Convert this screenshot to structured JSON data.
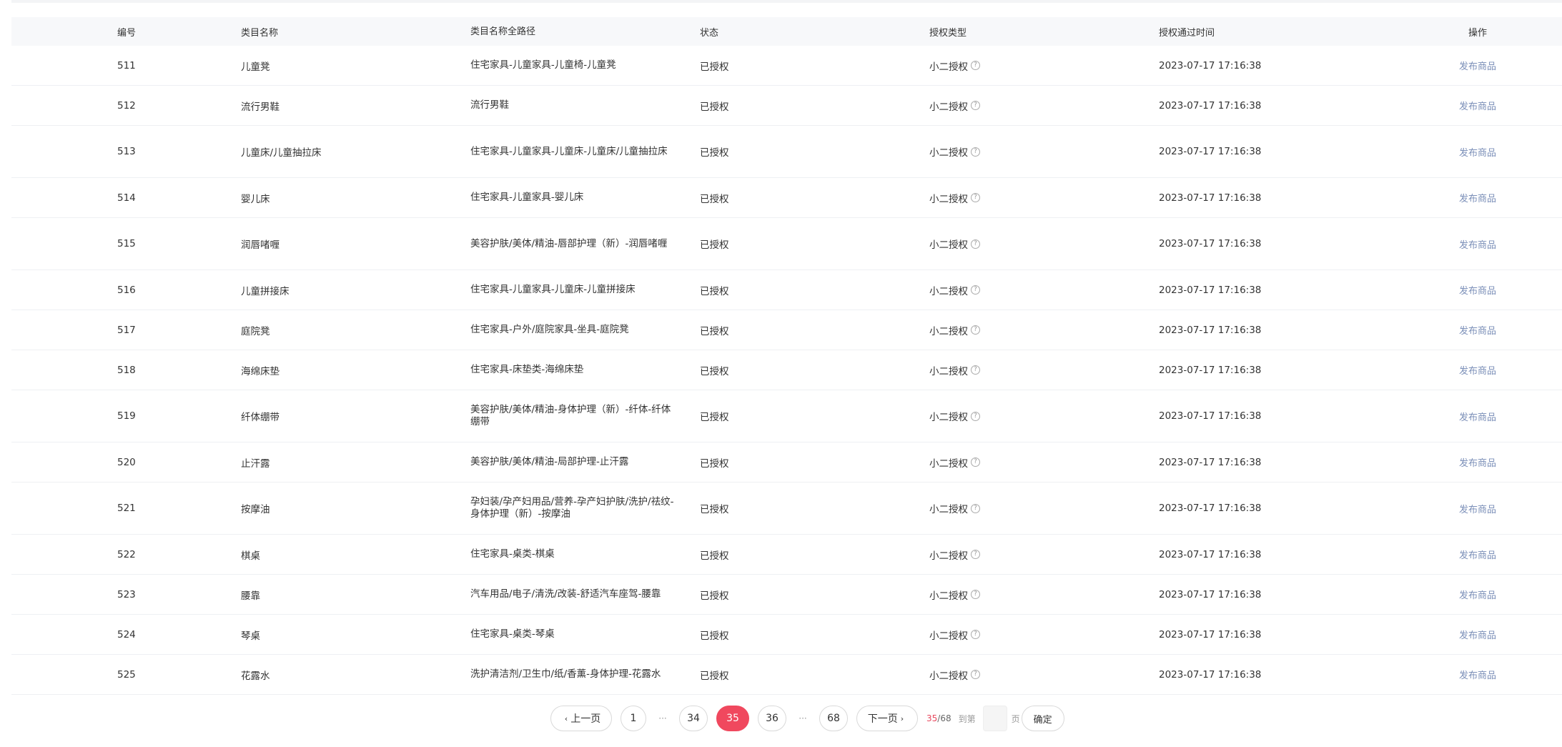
{
  "table": {
    "headers": [
      "编号",
      "类目名称",
      "类目名称全路径",
      "状态",
      "授权类型",
      "授权通过时间",
      "操作"
    ],
    "rows": [
      {
        "id": "511",
        "name": "儿童凳",
        "path": "住宅家具-儿童家具-儿童椅-儿童凳",
        "status": "已授权",
        "auth_type": "小二授权",
        "time": "2023-07-17 17:16:38",
        "action": "发布商品"
      },
      {
        "id": "512",
        "name": "流行男鞋",
        "path": "流行男鞋",
        "status": "已授权",
        "auth_type": "小二授权",
        "time": "2023-07-17 17:16:38",
        "action": "发布商品"
      },
      {
        "id": "513",
        "name": "儿童床/儿童抽拉床",
        "path": "住宅家具-儿童家具-儿童床-儿童床/儿童抽拉床",
        "status": "已授权",
        "auth_type": "小二授权",
        "time": "2023-07-17 17:16:38",
        "action": "发布商品"
      },
      {
        "id": "514",
        "name": "婴儿床",
        "path": "住宅家具-儿童家具-婴儿床",
        "status": "已授权",
        "auth_type": "小二授权",
        "time": "2023-07-17 17:16:38",
        "action": "发布商品"
      },
      {
        "id": "515",
        "name": "润唇啫喱",
        "path": "美容护肤/美体/精油-唇部护理（新）-润唇啫喱",
        "status": "已授权",
        "auth_type": "小二授权",
        "time": "2023-07-17 17:16:38",
        "action": "发布商品"
      },
      {
        "id": "516",
        "name": "儿童拼接床",
        "path": "住宅家具-儿童家具-儿童床-儿童拼接床",
        "status": "已授权",
        "auth_type": "小二授权",
        "time": "2023-07-17 17:16:38",
        "action": "发布商品"
      },
      {
        "id": "517",
        "name": "庭院凳",
        "path": "住宅家具-户外/庭院家具-坐具-庭院凳",
        "status": "已授权",
        "auth_type": "小二授权",
        "time": "2023-07-17 17:16:38",
        "action": "发布商品"
      },
      {
        "id": "518",
        "name": "海绵床垫",
        "path": "住宅家具-床垫类-海绵床垫",
        "status": "已授权",
        "auth_type": "小二授权",
        "time": "2023-07-17 17:16:38",
        "action": "发布商品"
      },
      {
        "id": "519",
        "name": "纤体绷带",
        "path": "美容护肤/美体/精油-身体护理（新）-纤体-纤体绷带",
        "status": "已授权",
        "auth_type": "小二授权",
        "time": "2023-07-17 17:16:38",
        "action": "发布商品"
      },
      {
        "id": "520",
        "name": "止汗露",
        "path": "美容护肤/美体/精油-局部护理-止汗露",
        "status": "已授权",
        "auth_type": "小二授权",
        "time": "2023-07-17 17:16:38",
        "action": "发布商品"
      },
      {
        "id": "521",
        "name": "按摩油",
        "path": "孕妇装/孕产妇用品/营养-孕产妇护肤/洗护/祛纹-身体护理（新）-按摩油",
        "status": "已授权",
        "auth_type": "小二授权",
        "time": "2023-07-17 17:16:38",
        "action": "发布商品"
      },
      {
        "id": "522",
        "name": "棋桌",
        "path": "住宅家具-桌类-棋桌",
        "status": "已授权",
        "auth_type": "小二授权",
        "time": "2023-07-17 17:16:38",
        "action": "发布商品"
      },
      {
        "id": "523",
        "name": "腰靠",
        "path": "汽车用品/电子/清洗/改装-舒适汽车座驾-腰靠",
        "status": "已授权",
        "auth_type": "小二授权",
        "time": "2023-07-17 17:16:38",
        "action": "发布商品"
      },
      {
        "id": "524",
        "name": "琴桌",
        "path": "住宅家具-桌类-琴桌",
        "status": "已授权",
        "auth_type": "小二授权",
        "time": "2023-07-17 17:16:38",
        "action": "发布商品"
      },
      {
        "id": "525",
        "name": "花露水",
        "path": "洗护清洁剂/卫生巾/纸/香薰-身体护理-花露水",
        "status": "已授权",
        "auth_type": "小二授权",
        "time": "2023-07-17 17:16:38",
        "action": "发布商品"
      }
    ]
  },
  "pagination": {
    "prev_label": "上一页",
    "next_label": "下一页",
    "pages": [
      "1",
      "34",
      "35",
      "36",
      "68"
    ],
    "ellipsis": "···",
    "current": "35",
    "total": "68",
    "separator": "/",
    "goto_label": "到第",
    "page_suffix": "页",
    "confirm_label": "确定"
  },
  "icons": {
    "help": "question-circle-icon",
    "prev": "chevron-left-icon",
    "next": "chevron-right-icon"
  },
  "colors": {
    "accent": "#f0485e",
    "link": "#7b8fb8",
    "header_bg": "#f7f8fa"
  }
}
